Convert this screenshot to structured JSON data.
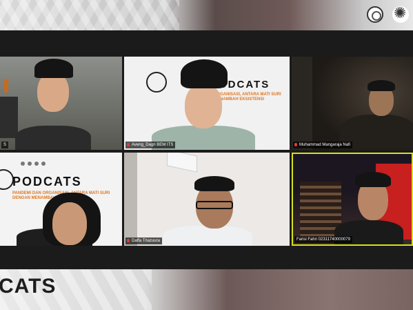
{
  "banner": {
    "bottom_text": "CATS"
  },
  "participants": [
    {
      "name": "S",
      "slot": "top-left"
    },
    {
      "name": "Aveng_Dagri BEM ITS",
      "slot": "top-center"
    },
    {
      "name": "Muhammad Mangaraja Nafi",
      "slot": "top-right"
    },
    {
      "name": "",
      "slot": "bottom-left"
    },
    {
      "name": "Daffa Trlazuura",
      "slot": "bottom-center"
    },
    {
      "name": "Farisi Fahri 02311740000079",
      "slot": "bottom-right",
      "active_speaker": true
    }
  ],
  "slides": {
    "top": {
      "title": "PODCATS",
      "subtitle_line1": "ORGANISASI, ANTARA MATI SURI",
      "subtitle_line2": "MENAMBAH EKSISTENSI"
    },
    "bottom": {
      "title": "PODCATS",
      "subtitle_line1": "PANDEMI DAN ORGANISASI, ANTARA MATI SURI",
      "subtitle_line2": "DENGAN MENAMBAH EKSISTENSI"
    }
  },
  "colors": {
    "active_speaker_border": "#d7e21a",
    "muted_mic": "#e23b3b",
    "slide_accent": "#e0761f"
  }
}
